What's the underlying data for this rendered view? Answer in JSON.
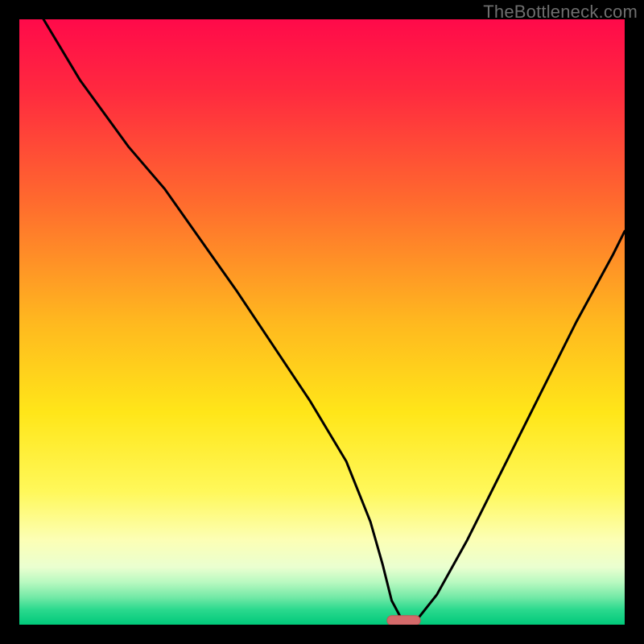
{
  "watermark": "TheBottleneck.com",
  "colors": {
    "frame": "#000000",
    "gradient_stops": [
      {
        "offset": 0.0,
        "color": "#ff0a4a"
      },
      {
        "offset": 0.12,
        "color": "#ff2a3f"
      },
      {
        "offset": 0.3,
        "color": "#ff6a2e"
      },
      {
        "offset": 0.5,
        "color": "#ffb81f"
      },
      {
        "offset": 0.65,
        "color": "#ffe619"
      },
      {
        "offset": 0.78,
        "color": "#fff85a"
      },
      {
        "offset": 0.86,
        "color": "#fcffb5"
      },
      {
        "offset": 0.905,
        "color": "#eaffd0"
      },
      {
        "offset": 0.93,
        "color": "#b8f9c0"
      },
      {
        "offset": 0.955,
        "color": "#72e9a6"
      },
      {
        "offset": 0.975,
        "color": "#2bd98e"
      },
      {
        "offset": 1.0,
        "color": "#00c97a"
      }
    ],
    "curve_stroke": "#000000",
    "marker_fill": "#d46a6a",
    "marker_stroke": "#c05656"
  },
  "chart_data": {
    "type": "line",
    "title": "",
    "xlabel": "",
    "ylabel": "",
    "xlim": [
      0,
      100
    ],
    "ylim": [
      0,
      100
    ],
    "annotations": [],
    "series": [
      {
        "name": "bottleneck-curve",
        "x": [
          4,
          10,
          18,
          24,
          30,
          36,
          42,
          48,
          54,
          58,
          60,
          61.5,
          63,
          64.5,
          66,
          69,
          74,
          80,
          86,
          92,
          98,
          100
        ],
        "values": [
          100,
          90,
          79,
          72,
          63.5,
          55,
          46,
          37,
          27,
          17,
          10,
          4,
          1.2,
          0.7,
          1.2,
          5,
          14,
          26,
          38,
          50,
          61,
          65
        ]
      }
    ],
    "marker": {
      "x_center": 63.5,
      "y_center": 0.7,
      "width": 5.5,
      "height": 1.6
    },
    "legend": null,
    "grid": false
  }
}
